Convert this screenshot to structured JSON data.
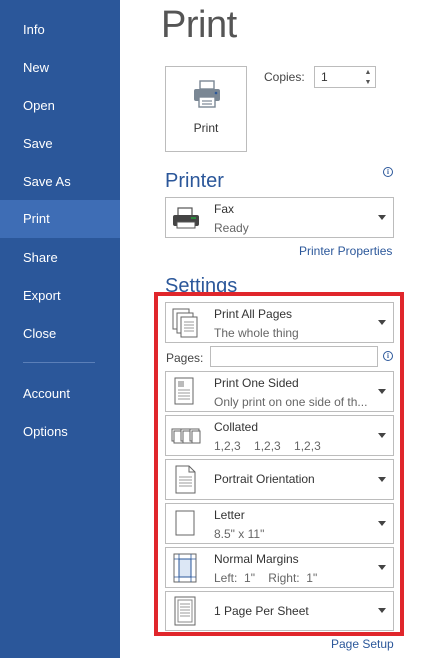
{
  "sidebar": {
    "items": [
      {
        "label": "Info"
      },
      {
        "label": "New"
      },
      {
        "label": "Open"
      },
      {
        "label": "Save"
      },
      {
        "label": "Save As"
      },
      {
        "label": "Print"
      },
      {
        "label": "Share"
      },
      {
        "label": "Export"
      },
      {
        "label": "Close"
      },
      {
        "label": "Account"
      },
      {
        "label": "Options"
      }
    ],
    "active": "Print"
  },
  "main": {
    "title": "Print",
    "print_button": {
      "label": "Print",
      "icon": "printer-icon"
    },
    "copies": {
      "label": "Copies:",
      "value": "1"
    },
    "printer": {
      "section_title": "Printer",
      "name": "Fax",
      "status": "Ready",
      "properties_link": "Printer Properties"
    },
    "settings": {
      "section_title": "Settings",
      "print_range": {
        "main": "Print All Pages",
        "sub": "The whole thing"
      },
      "pages": {
        "label": "Pages:",
        "value": "",
        "placeholder": ""
      },
      "sides": {
        "main": "Print One Sided",
        "sub": "Only print on one side of th..."
      },
      "collation": {
        "main": "Collated",
        "sub": "1,2,3    1,2,3    1,2,3"
      },
      "orientation": {
        "main": "Portrait Orientation"
      },
      "paper": {
        "main": "Letter",
        "sub": "8.5\" x 11\""
      },
      "margins": {
        "main": "Normal Margins",
        "sub": "Left:  1\"    Right:  1\""
      },
      "pages_per_sheet": {
        "main": "1 Page Per Sheet"
      },
      "page_setup_link": "Page Setup"
    }
  },
  "colors": {
    "sidebar_bg": "#2b579a",
    "sidebar_active": "#3e6db5",
    "accent": "#2b579a",
    "highlight_frame": "#e0262b"
  }
}
